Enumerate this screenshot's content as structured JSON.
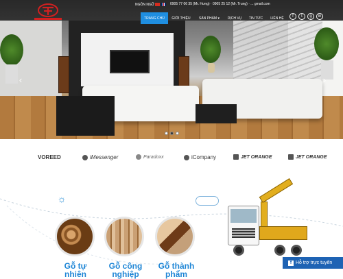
{
  "header": {
    "language_label": "NGÔN NGỮ",
    "contact_line": "0905 77 06 35 (Mr. Hưng) · 0905 25 12 (Mr. Trung) · ... gmail.com"
  },
  "nav": {
    "items": [
      {
        "label": "TRANG CHỦ"
      },
      {
        "label": "GIỚI THIỆU"
      },
      {
        "label": "SẢN PHẨM ▾"
      },
      {
        "label": "DỊCH VỤ"
      },
      {
        "label": "TIN TỨC"
      },
      {
        "label": "LIÊN HỆ"
      }
    ]
  },
  "social": [
    "f",
    "t",
    "g",
    "in"
  ],
  "slider": {
    "prev": "‹",
    "next": "›",
    "active_dot": 1
  },
  "brands": [
    {
      "label": "VOREED"
    },
    {
      "label": "iMessenger"
    },
    {
      "label": "Paradoxx"
    },
    {
      "label": "iCompany"
    },
    {
      "label": "JET ORANGE"
    },
    {
      "label": "JET ORANGE"
    }
  ],
  "products": [
    {
      "title": "Gỗ tự nhiên"
    },
    {
      "title": "Gỗ công nghiệp"
    },
    {
      "title": "Gỗ thành phẩm"
    }
  ],
  "chat": {
    "label": "Hỗ trợ trực tuyến",
    "icon": "f"
  },
  "colors": {
    "accent": "#1f8ee0",
    "title_blue": "#1f86d6",
    "chat_blue": "#1e63b4",
    "logo_red": "#d22020"
  }
}
